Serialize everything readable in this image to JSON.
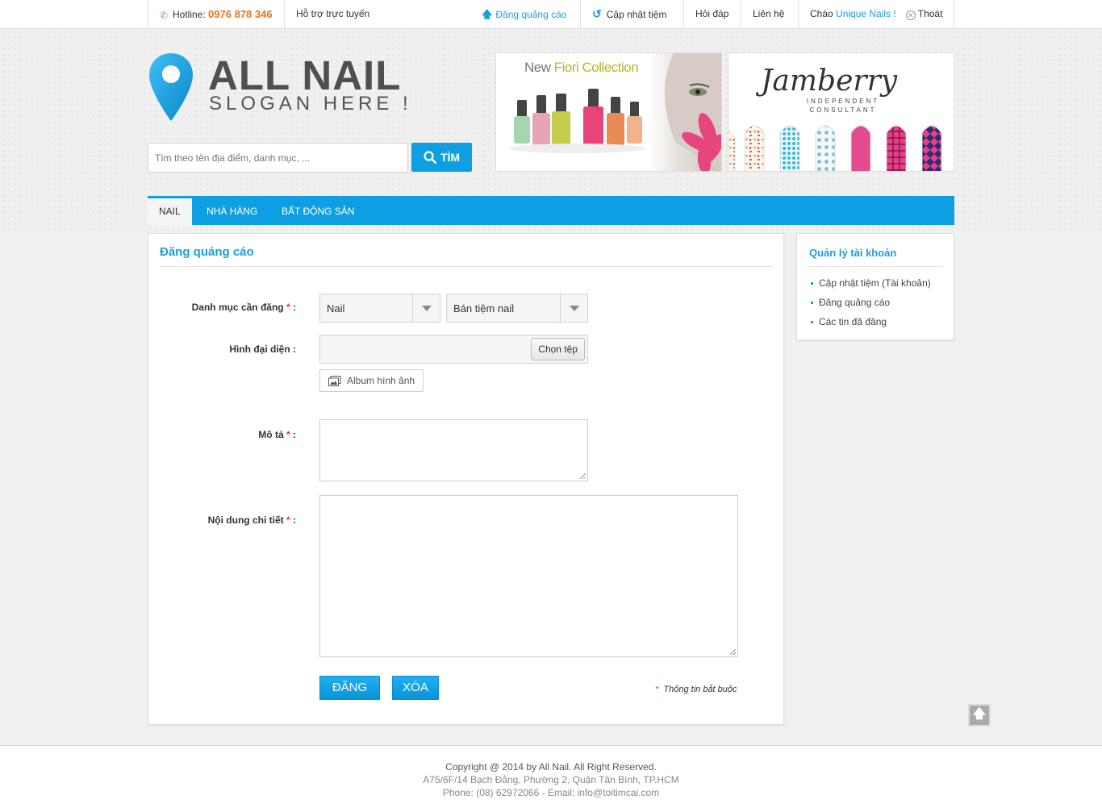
{
  "topbar": {
    "hotline_label": "Hotline:",
    "hotline_number": "0976 878 346",
    "support": "Hỗ trợ trực tuyến",
    "post_ad": "Đăng quảng cáo",
    "update_store": "Cập nhật tiệm",
    "faq": "Hỏi đáp",
    "contact": "Liên hệ",
    "greeting": "Chào",
    "username": "Unique Nails !",
    "logout": "Thoát"
  },
  "header": {
    "logo_title": "ALL NAIL",
    "logo_slogan": "SLOGAN HERE !",
    "search_placeholder": "Tìm theo tên địa điểm, danh mục, ...",
    "search_button": "TÌM",
    "banner1_prefix": "New",
    "banner1_highlight": "Fiori Collection",
    "banner2_logo": "Jamberry",
    "banner2_sub": "INDEPENDENT CONSULTANT"
  },
  "nav": {
    "items": [
      "NAIL",
      "NHÀ HÀNG",
      "BẤT ĐỘNG SẢN"
    ]
  },
  "form": {
    "title": "Đăng quảng cáo",
    "category_label": "Danh mục cần đăng",
    "category_value": "Nail",
    "subcategory_value": "Bán tiệm nail",
    "avatar_label": "Hình đại diện :",
    "choose_file": "Chọn tệp",
    "album_button": "Album hình ảnh",
    "description_label": "Mô tả",
    "detail_label": "Nội dung chi tiết",
    "required_mark": "*",
    "colon": ":",
    "submit": "ĐĂNG",
    "clear": "XÓA",
    "required_note": "Thông tin bắt buộc"
  },
  "sidebar": {
    "title": "Quản lý tài khoản",
    "links": [
      "Cập nhật tiệm (Tài khoản)",
      "Đăng quảng cáo",
      "Các tin đã đăng"
    ]
  },
  "footer": {
    "copyright": "Copyright @ 2014 by All Nail. All Right Reserved.",
    "address": "A75/6F/14 Bạch Đằng, Phường 2, Quận Tân Bình, TP.HCM",
    "contact": "Phone: (08) 62972066 - Email: info@toitimcai.com"
  },
  "colors": {
    "accent": "#0e9fe2",
    "hotline": "#e8731a",
    "required": "#e33333"
  },
  "icons": {
    "phone": "phone-icon",
    "upload": "upload-arrow-icon",
    "refresh": "refresh-icon",
    "close": "close-circle-icon",
    "search": "search-icon",
    "album": "album-icon",
    "back_to_top": "arrow-up-icon"
  }
}
